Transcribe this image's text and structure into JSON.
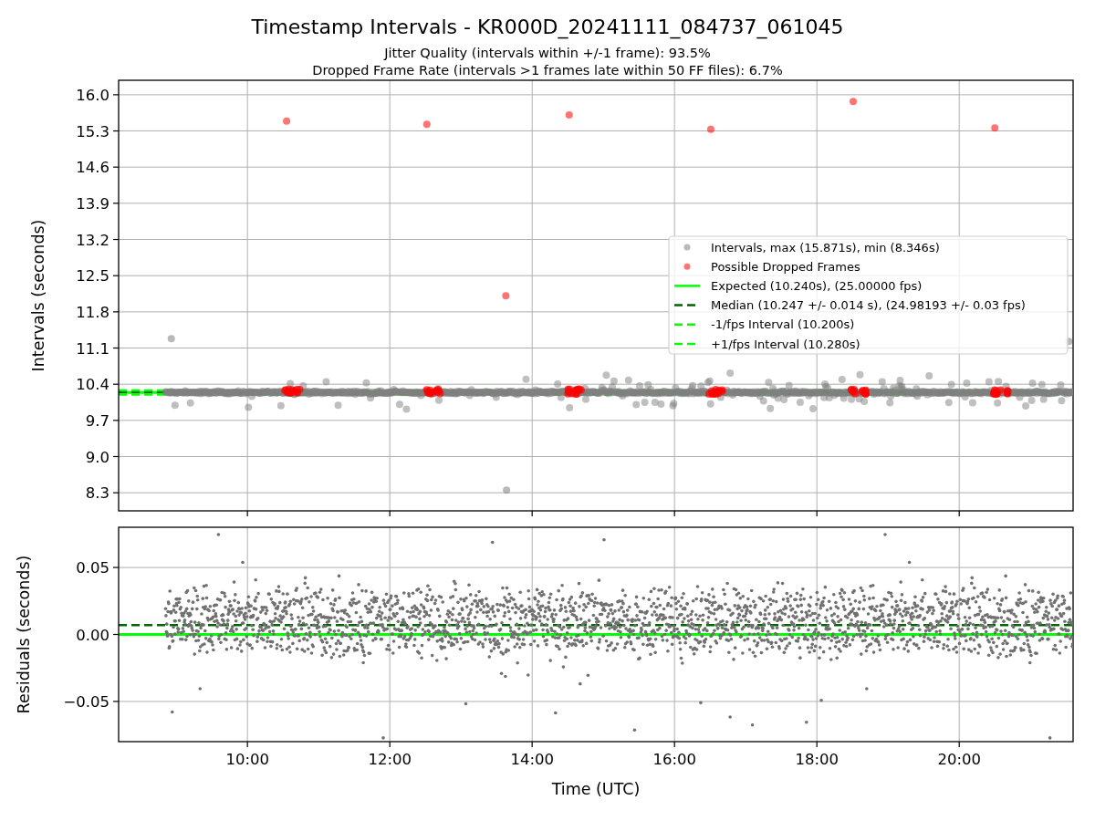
{
  "title": "Timestamp Intervals - KR000D_20241111_084737_061045",
  "subtitles": [
    "Jitter Quality (intervals within +/-1 frame): 93.5%",
    "Dropped Frame Rate (intervals >1 frames late within 50 FF files): 6.7%"
  ],
  "panels": [
    {
      "chart_data": {
        "type": "scatter",
        "ylabel": "Intervals (seconds)",
        "xlim": [
          8.19,
          21.6
        ],
        "ylim": [
          7.95,
          16.28
        ],
        "yticks": [
          {
            "value": 8.3,
            "label": "8.3"
          },
          {
            "value": 9.0,
            "label": "9.0"
          },
          {
            "value": 9.7,
            "label": "9.7"
          },
          {
            "value": 10.4,
            "label": "10.4"
          },
          {
            "value": 11.1,
            "label": "11.1"
          },
          {
            "value": 11.8,
            "label": "11.8"
          },
          {
            "value": 12.5,
            "label": "12.5"
          },
          {
            "value": 13.2,
            "label": "13.2"
          },
          {
            "value": 13.9,
            "label": "13.9"
          },
          {
            "value": 14.6,
            "label": "14.6"
          },
          {
            "value": 15.3,
            "label": "15.3"
          },
          {
            "value": 16.0,
            "label": "16.0"
          }
        ],
        "grid": true,
        "legend": "center right",
        "series": [
          {
            "name": "Intervals, max (15.871s), min (8.346s)",
            "color": "#808080",
            "x": [
              8.93,
              13.64,
              21.54
            ],
            "values": [
              11.28,
              8.35,
              11.23
            ]
          },
          {
            "name": "Possible Dropped Frames",
            "color": "#ff0000",
            "x": [
              10.55,
              12.52,
              13.63,
              14.52,
              16.51,
              18.51,
              20.5
            ],
            "values": [
              15.49,
              15.43,
              12.11,
              15.61,
              15.33,
              15.87,
              15.36
            ]
          }
        ],
        "ref_lines": [
          {
            "axis": "y",
            "value": 10.24,
            "label": "Expected (10.240s), (25.00000 fps)",
            "color": "#00ff00"
          },
          {
            "axis": "y",
            "value": 10.247,
            "label": "Median (10.247 +/- 0.014 s), (24.98193 +/- 0.03 fps)",
            "color": "#006400"
          },
          {
            "axis": "y",
            "value": 10.2,
            "label": "-1/fps Interval (10.200s)",
            "color": "#00ff00"
          },
          {
            "axis": "y",
            "value": 10.28,
            "label": "+1/fps Interval (10.280s)",
            "color": "#00ff00"
          }
        ]
      }
    },
    {
      "chart_data": {
        "type": "scatter",
        "xlabel": "Time (UTC)",
        "ylabel": "Residuals (seconds)",
        "xlim": [
          8.19,
          21.6
        ],
        "ylim": [
          -0.08,
          0.08
        ],
        "xticks": [
          {
            "value": 10,
            "label": "10:00"
          },
          {
            "value": 12,
            "label": "12:00"
          },
          {
            "value": 14,
            "label": "14:00"
          },
          {
            "value": 16,
            "label": "16:00"
          },
          {
            "value": 18,
            "label": "18:00"
          },
          {
            "value": 20,
            "label": "20:00"
          }
        ],
        "yticks": [
          {
            "value": -0.05,
            "label": "−0.05"
          },
          {
            "value": 0,
            "label": "0.00"
          },
          {
            "value": 0.05,
            "label": "0.05"
          }
        ],
        "grid": true,
        "ref_lines": [
          {
            "axis": "y",
            "value": 0,
            "color": "#00ff00"
          },
          {
            "axis": "y",
            "value": 0.007,
            "color": "#006400"
          }
        ]
      }
    }
  ]
}
